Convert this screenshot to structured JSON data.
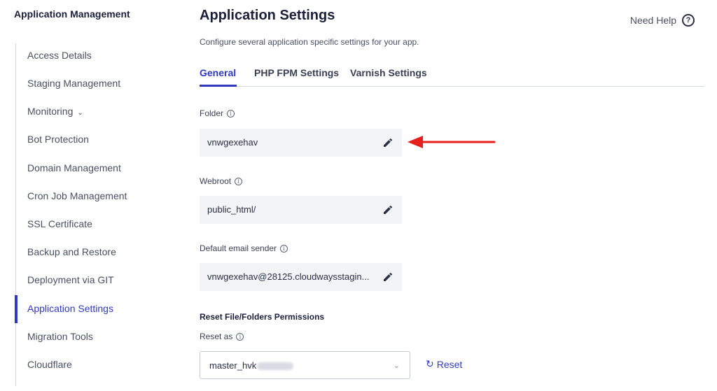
{
  "sidebar": {
    "title": "Application Management",
    "items": [
      {
        "label": "Access Details"
      },
      {
        "label": "Staging Management"
      },
      {
        "label": "Monitoring",
        "chevron": "⌄"
      },
      {
        "label": "Bot Protection"
      },
      {
        "label": "Domain Management"
      },
      {
        "label": "Cron Job Management"
      },
      {
        "label": "SSL Certificate"
      },
      {
        "label": "Backup and Restore"
      },
      {
        "label": "Deployment via GIT"
      },
      {
        "label": "Application Settings",
        "active": true
      },
      {
        "label": "Migration Tools"
      },
      {
        "label": "Cloudflare"
      }
    ]
  },
  "header": {
    "title": "Application Settings",
    "subtitle": "Configure several application specific settings for your app.",
    "help_label": "Need Help",
    "help_icon": "?"
  },
  "tabs": [
    {
      "label": "General",
      "active": true
    },
    {
      "label": "PHP FPM Settings"
    },
    {
      "label": "Varnish Settings"
    }
  ],
  "fields": {
    "folder": {
      "label": "Folder",
      "value": "vnwgexehav"
    },
    "webroot": {
      "label": "Webroot",
      "value": "public_html/"
    },
    "email_sender": {
      "label": "Default email sender",
      "value": "vnwgexehav@28125.cloudwaysstagin..."
    }
  },
  "info_icon": "i",
  "permissions": {
    "heading": "Reset File/Folders Permissions",
    "reset_as_label": "Reset as",
    "selected_value": "master_hvk",
    "select_chevron": "⌄",
    "reset_label": "Reset",
    "reset_icon": "↻"
  },
  "colors": {
    "accent": "#2f39bf",
    "annotation_arrow": "#e3201b",
    "field_bg": "#f3f4f7"
  }
}
